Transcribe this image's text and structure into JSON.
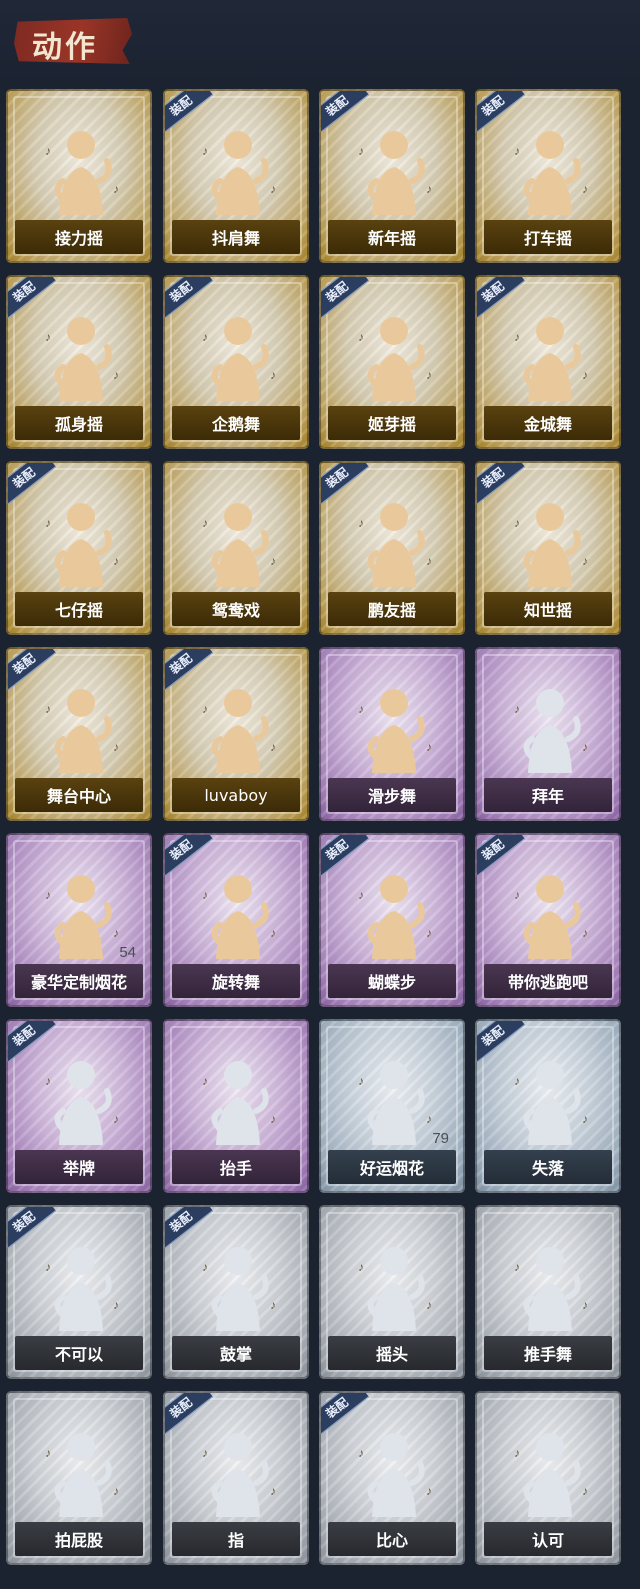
{
  "header": {
    "title": "动作"
  },
  "equip_label": "装配",
  "items": [
    {
      "name": "接力摇",
      "rarity": "gold",
      "equipped": false,
      "icon": "figure-dance-icon"
    },
    {
      "name": "抖肩舞",
      "rarity": "gold",
      "equipped": true,
      "icon": "figure-dance-icon"
    },
    {
      "name": "新年摇",
      "rarity": "gold",
      "equipped": true,
      "icon": "figure-dance-icon"
    },
    {
      "name": "打车摇",
      "rarity": "gold",
      "equipped": true,
      "icon": "figure-dance-icon"
    },
    {
      "name": "孤身摇",
      "rarity": "gold",
      "equipped": true,
      "icon": "figure-dance-icon"
    },
    {
      "name": "企鹅舞",
      "rarity": "gold",
      "equipped": true,
      "icon": "figure-dance-icon"
    },
    {
      "name": "姬芽摇",
      "rarity": "gold",
      "equipped": true,
      "icon": "figure-dance-icon"
    },
    {
      "name": "金城舞",
      "rarity": "gold",
      "equipped": true,
      "icon": "figure-dance-icon"
    },
    {
      "name": "七仔摇",
      "rarity": "gold",
      "equipped": true,
      "icon": "figure-dance-icon"
    },
    {
      "name": "鸳鸯戏",
      "rarity": "gold",
      "equipped": false,
      "icon": "figure-dance-icon"
    },
    {
      "name": "鹏友摇",
      "rarity": "gold",
      "equipped": true,
      "icon": "figure-dance-icon"
    },
    {
      "name": "知世摇",
      "rarity": "gold",
      "equipped": true,
      "icon": "figure-dance-icon"
    },
    {
      "name": "舞台中心",
      "rarity": "gold",
      "equipped": true,
      "icon": "figure-dance-icon"
    },
    {
      "name": "luvaboy",
      "rarity": "gold",
      "equipped": true,
      "icon": "figure-dance-icon"
    },
    {
      "name": "滑步舞",
      "rarity": "purple",
      "equipped": false,
      "icon": "figure-dance-icon"
    },
    {
      "name": "拜年",
      "rarity": "purple",
      "equipped": false,
      "icon": "figure-bow-icon"
    },
    {
      "name": "豪华定制烟花",
      "rarity": "purple",
      "equipped": false,
      "icon": "fireworks-icon",
      "count": "54"
    },
    {
      "name": "旋转舞",
      "rarity": "purple",
      "equipped": true,
      "icon": "figure-spin-icon"
    },
    {
      "name": "蝴蝶步",
      "rarity": "purple",
      "equipped": true,
      "icon": "figure-dance-icon"
    },
    {
      "name": "带你逃跑吧",
      "rarity": "purple",
      "equipped": true,
      "icon": "figure-dance-icon"
    },
    {
      "name": "举牌",
      "rarity": "purple",
      "equipped": true,
      "icon": "sign-holder-icon"
    },
    {
      "name": "抬手",
      "rarity": "purple",
      "equipped": false,
      "icon": "figure-wave-icon"
    },
    {
      "name": "好运烟花",
      "rarity": "blue",
      "equipped": false,
      "icon": "firework-canister-icon",
      "count": "79"
    },
    {
      "name": "失落",
      "rarity": "blue",
      "equipped": true,
      "icon": "figure-crawl-icon"
    },
    {
      "name": "不可以",
      "rarity": "gray",
      "equipped": true,
      "icon": "finger-wag-icon"
    },
    {
      "name": "鼓掌",
      "rarity": "gray",
      "equipped": true,
      "icon": "clap-icon"
    },
    {
      "name": "摇头",
      "rarity": "gray",
      "equipped": false,
      "icon": "figure-shake-icon"
    },
    {
      "name": "推手舞",
      "rarity": "gray",
      "equipped": false,
      "icon": "figure-push-icon"
    },
    {
      "name": "拍屁股",
      "rarity": "gray",
      "equipped": false,
      "icon": "figure-spank-icon"
    },
    {
      "name": "指",
      "rarity": "gray",
      "equipped": true,
      "icon": "point-hand-icon"
    },
    {
      "name": "比心",
      "rarity": "gray",
      "equipped": true,
      "icon": "finger-heart-icon"
    },
    {
      "name": "认可",
      "rarity": "gray",
      "equipped": false,
      "icon": "thumbs-up-icon"
    }
  ]
}
